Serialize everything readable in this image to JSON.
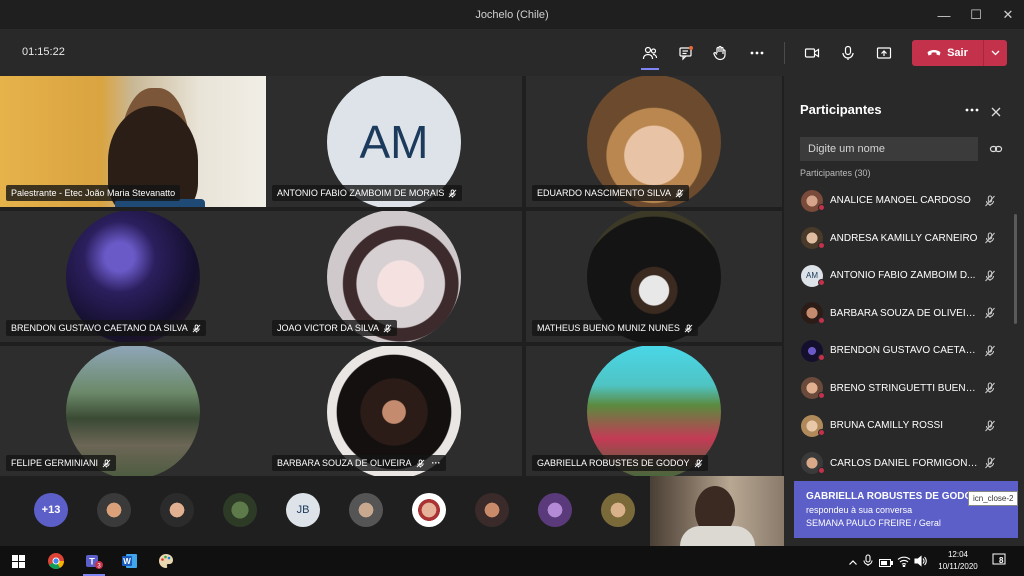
{
  "window": {
    "title": "Jochelo (Chile)"
  },
  "toolbar": {
    "timer": "01:15:22",
    "leave_label": "Sair"
  },
  "tiles": [
    {
      "name": "Palestrante - Etec João Maria Stevanatto",
      "muted": false
    },
    {
      "name": "ANTONIO FABIO ZAMBOIM DE MORAIS",
      "initials": "AM",
      "muted": true
    },
    {
      "name": "EDUARDO NASCIMENTO SILVA",
      "muted": true
    },
    {
      "name": "BRENDON GUSTAVO CAETANO DA SILVA",
      "muted": true
    },
    {
      "name": "JOAO VICTOR DA SILVA",
      "muted": true
    },
    {
      "name": "MATHEUS BUENO MUNIZ NUNES",
      "muted": true
    },
    {
      "name": "FELIPE GERMINIANI",
      "muted": true
    },
    {
      "name": "BARBARA SOUZA DE OLIVEIRA",
      "muted": true,
      "more": "···"
    },
    {
      "name": "GABRIELLA ROBUSTES DE GODOY",
      "muted": true
    }
  ],
  "strip": {
    "overflow_count": "+13",
    "initials": "JB"
  },
  "panel": {
    "title": "Participantes",
    "search_placeholder": "Digite um nome",
    "count_label": "Participantes (30)",
    "participants": [
      {
        "name": "ANALICE MANOEL CARDOSO"
      },
      {
        "name": "ANDRESA KAMILLY CARNEIRO"
      },
      {
        "name": "ANTONIO FABIO ZAMBOIM D...",
        "initials": "AM"
      },
      {
        "name": "BARBARA SOUZA DE OLIVEIRA"
      },
      {
        "name": "BRENDON GUSTAVO CAETAN..."
      },
      {
        "name": "BRENO STRINGUETTI BUENO ..."
      },
      {
        "name": "BRUNA CAMILLY ROSSI"
      },
      {
        "name": "CARLOS DANIEL FORMIGONI ..."
      }
    ]
  },
  "toast": {
    "sender": "GABRIELLA ROBUSTES DE GODOY",
    "message": "respondeu à sua conversa",
    "channel": "SEMANA PAULO FREIRE / Geral",
    "tooltip": "icn_close-2"
  },
  "taskbar": {
    "time": "12:04",
    "date": "10/11/2020",
    "notifications": "8"
  },
  "colors": {
    "accent": "#5b5fc7",
    "leave": "#c4314b",
    "panel": "#292929",
    "tile": "#2d2d2d"
  }
}
